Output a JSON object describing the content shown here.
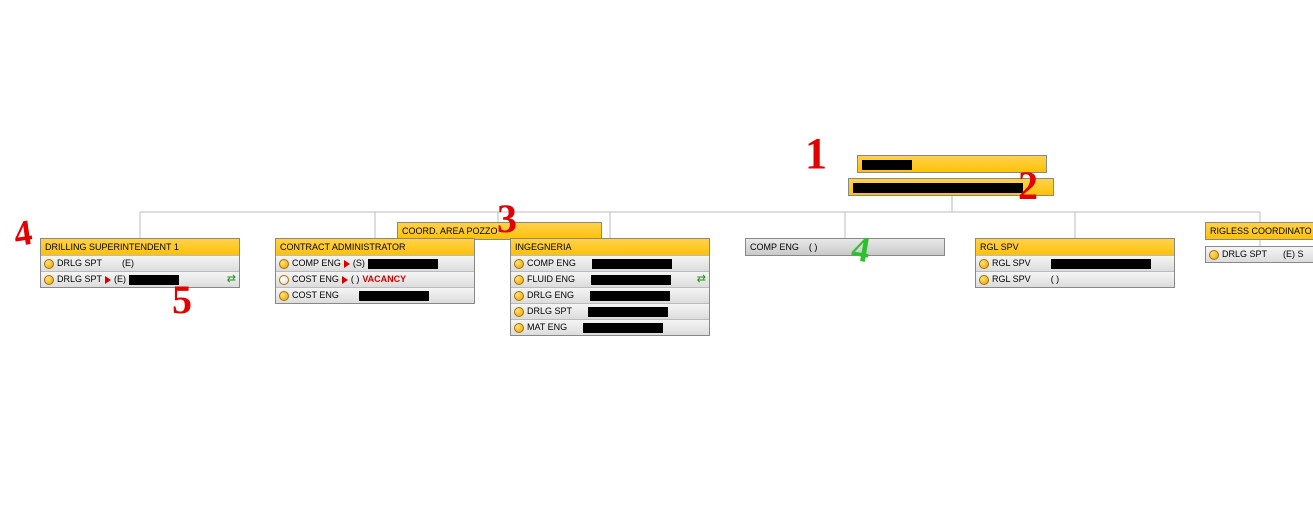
{
  "top": {
    "title_redacted": "",
    "subtitle_redacted": ""
  },
  "coord": {
    "title": "COORD. AREA POZZO"
  },
  "rigless": {
    "title": "RIGLESS COORDINATO"
  },
  "drilling_sup": {
    "title": "DRILLING SUPERINTENDENT 1",
    "rows": [
      {
        "role": "DRLG SPT",
        "paren": "(E)",
        "bullet": "solid"
      },
      {
        "role": "DRLG SPT",
        "paren": "(E)",
        "bullet": "solid",
        "tri": true,
        "redact": "w50",
        "swap": true
      }
    ]
  },
  "contract_admin": {
    "title": "CONTRACT ADMINISTRATOR",
    "rows": [
      {
        "role": "COMP ENG",
        "paren": "(S)",
        "bullet": "solid",
        "tri": true,
        "redact": "w70"
      },
      {
        "role": "COST ENG",
        "paren": "( )",
        "bullet": "hollow",
        "tri": true,
        "vacancy": "VACANCY"
      },
      {
        "role": "COST ENG",
        "bullet": "solid",
        "redact": "w70"
      }
    ]
  },
  "ingegneria": {
    "title": "INGEGNERIA",
    "rows": [
      {
        "role": "COMP ENG",
        "bullet": "solid",
        "redact": "w80"
      },
      {
        "role": "FLUID ENG",
        "bullet": "solid",
        "redact": "w80",
        "swap": true
      },
      {
        "role": "DRLG ENG",
        "bullet": "solid",
        "redact": "w80"
      },
      {
        "role": "DRLG SPT",
        "bullet": "solid",
        "redact": "w80"
      },
      {
        "role": "MAT ENG",
        "bullet": "solid",
        "redact": "w80"
      }
    ]
  },
  "comp_eng_box": {
    "title_role": "COMP ENG",
    "title_paren": "( )"
  },
  "rgl_spv": {
    "title": "RGL SPV",
    "rows": [
      {
        "role": "RGL SPV",
        "bullet": "solid",
        "redact": "w100"
      },
      {
        "role": "RGL SPV",
        "paren": "( )",
        "bullet": "solid"
      }
    ]
  },
  "rigless_child": {
    "rows": [
      {
        "role": "DRLG SPT",
        "paren": "(E) S",
        "bullet": "solid"
      }
    ]
  },
  "annotations": {
    "a1": "1",
    "a2": "2",
    "a3": "3",
    "a4": "4",
    "a5": "5",
    "a_green4": "4"
  }
}
